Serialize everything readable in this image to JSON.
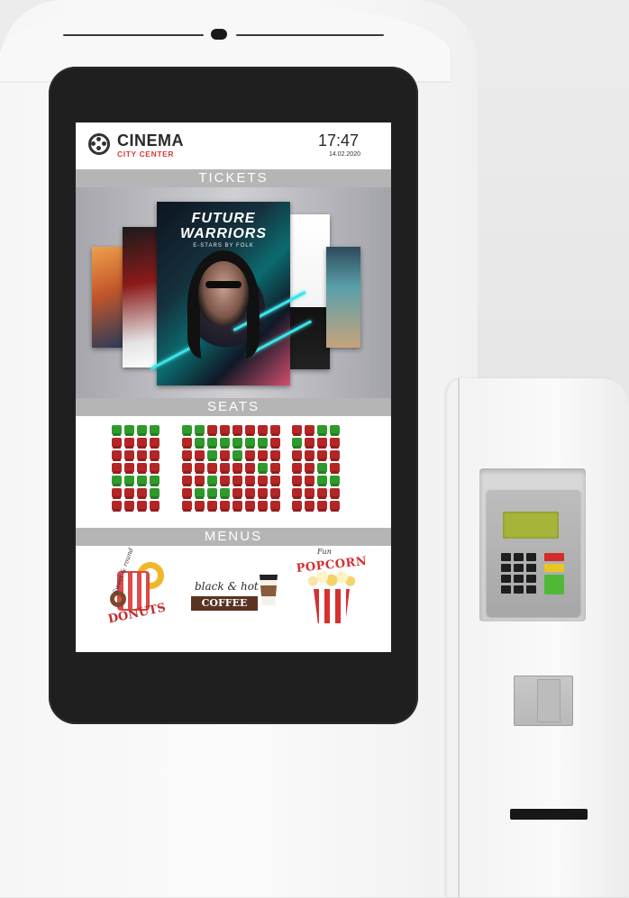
{
  "header": {
    "brand_title": "CINEMA",
    "brand_subtitle": "CITY CENTER",
    "time": "17:47",
    "date": "14.02.2020"
  },
  "sections": {
    "tickets": "TICKETS",
    "seats": "SEATS",
    "menus": "MENUS"
  },
  "featured_poster": {
    "title_line1": "FUTURE",
    "title_line2": "WARRIORS",
    "subtitle": "E-STARS BY FOLK"
  },
  "seat_map": {
    "colors": {
      "taken": "#b42626",
      "free": "#2f9a2b"
    },
    "left_block": [
      [
        "G",
        "G",
        "G",
        "G"
      ],
      [
        "R",
        "R",
        "R",
        "R"
      ],
      [
        "R",
        "R",
        "R",
        "R"
      ],
      [
        "R",
        "R",
        "R",
        "R"
      ],
      [
        "G",
        "G",
        "G",
        "G"
      ],
      [
        "R",
        "R",
        "R",
        "G"
      ],
      [
        "R",
        "R",
        "R",
        "R"
      ]
    ],
    "center_block": [
      [
        "G",
        "G",
        "R",
        "R",
        "R",
        "R",
        "R",
        "R"
      ],
      [
        "R",
        "G",
        "G",
        "G",
        "G",
        "G",
        "G",
        "R"
      ],
      [
        "R",
        "R",
        "G",
        "R",
        "G",
        "R",
        "R",
        "R"
      ],
      [
        "R",
        "R",
        "R",
        "R",
        "R",
        "R",
        "G",
        "R"
      ],
      [
        "R",
        "R",
        "G",
        "R",
        "R",
        "R",
        "R",
        "R"
      ],
      [
        "R",
        "G",
        "G",
        "G",
        "R",
        "R",
        "R",
        "R"
      ],
      [
        "R",
        "R",
        "R",
        "R",
        "R",
        "R",
        "R",
        "R"
      ]
    ],
    "right_block": [
      [
        "R",
        "R",
        "G",
        "G"
      ],
      [
        "G",
        "R",
        "R",
        "R"
      ],
      [
        "R",
        "R",
        "R",
        "R"
      ],
      [
        "R",
        "R",
        "G",
        "R"
      ],
      [
        "R",
        "R",
        "G",
        "G"
      ],
      [
        "R",
        "R",
        "R",
        "R"
      ],
      [
        "R",
        "R",
        "R",
        "R"
      ]
    ]
  },
  "menus": {
    "donuts": {
      "label": "DONUTS",
      "tagline": "Sweet & round"
    },
    "coffee": {
      "script": "black & hot",
      "label": "COFFEE"
    },
    "popcorn": {
      "label": "POPCORN",
      "tagline": "Fun"
    }
  }
}
